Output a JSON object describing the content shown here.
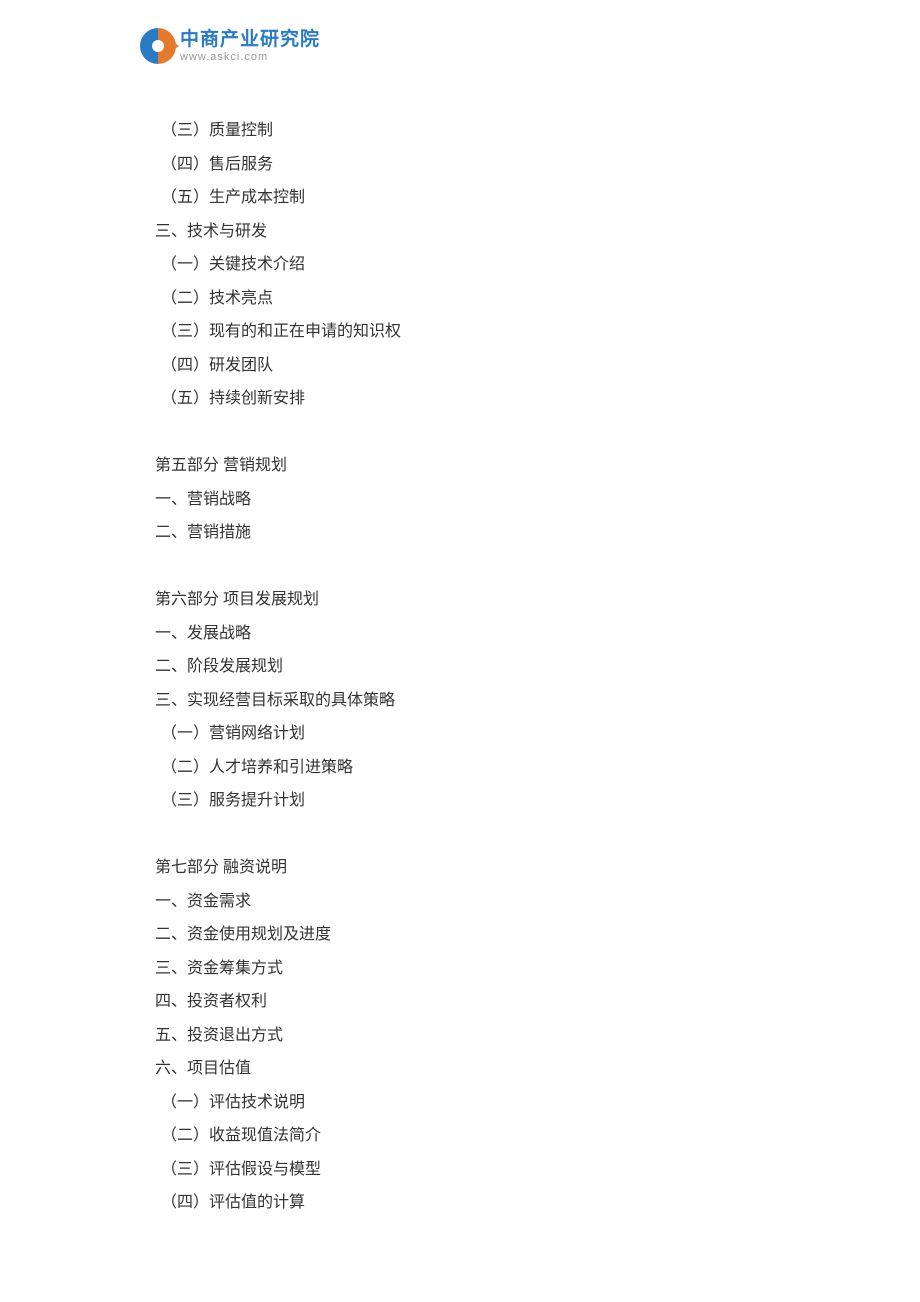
{
  "header": {
    "title": "中商产业研究院",
    "subtitle": "www.askci.com"
  },
  "content": {
    "lines": [
      {
        "text": "（三）质量控制",
        "sub": true
      },
      {
        "text": "（四）售后服务",
        "sub": true
      },
      {
        "text": "（五）生产成本控制",
        "sub": true
      },
      {
        "text": "三、技术与研发",
        "sub": false
      },
      {
        "text": "（一）关键技术介绍",
        "sub": true
      },
      {
        "text": "（二）技术亮点",
        "sub": true
      },
      {
        "text": "（三）现有的和正在申请的知识权",
        "sub": true
      },
      {
        "text": "（四）研发团队",
        "sub": true
      },
      {
        "text": "（五）持续创新安排",
        "sub": true
      },
      {
        "gap": true
      },
      {
        "text": "第五部分  营销规划",
        "sub": false
      },
      {
        "text": "一、营销战略",
        "sub": false
      },
      {
        "text": "二、营销措施",
        "sub": false
      },
      {
        "gap": true
      },
      {
        "text": "第六部分  项目发展规划",
        "sub": false
      },
      {
        "text": "一、发展战略",
        "sub": false
      },
      {
        "text": "二、阶段发展规划",
        "sub": false
      },
      {
        "text": "三、实现经营目标采取的具体策略",
        "sub": false
      },
      {
        "text": "（一）营销网络计划",
        "sub": true
      },
      {
        "text": "（二）人才培养和引进策略",
        "sub": true
      },
      {
        "text": "（三）服务提升计划",
        "sub": true
      },
      {
        "gap": true
      },
      {
        "text": "第七部分  融资说明",
        "sub": false
      },
      {
        "text": "一、资金需求",
        "sub": false
      },
      {
        "text": "二、资金使用规划及进度",
        "sub": false
      },
      {
        "text": "三、资金筹集方式",
        "sub": false
      },
      {
        "text": "四、投资者权利",
        "sub": false
      },
      {
        "text": "五、投资退出方式",
        "sub": false
      },
      {
        "text": "六、项目估值",
        "sub": false
      },
      {
        "text": "（一）评估技术说明",
        "sub": true
      },
      {
        "text": "（二）收益现值法简介",
        "sub": true
      },
      {
        "text": "（三）评估假设与模型",
        "sub": true
      },
      {
        "text": "（四）评估值的计算",
        "sub": true
      }
    ]
  }
}
